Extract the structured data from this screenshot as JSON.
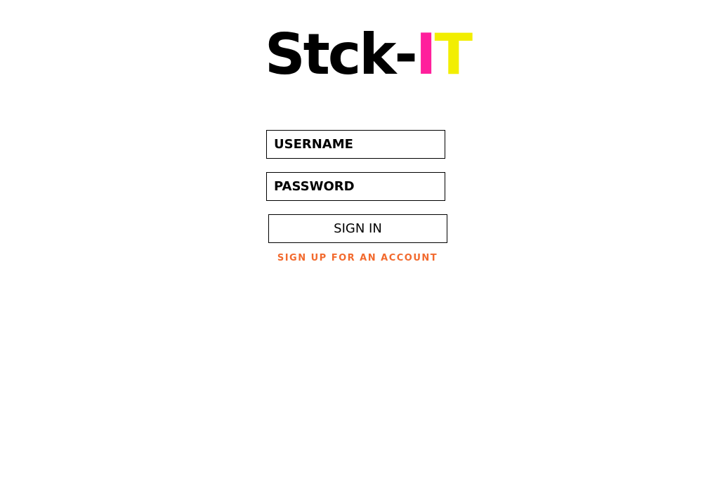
{
  "logo": {
    "text_base": "Stck-",
    "text_i": "I",
    "text_t": "T",
    "colors": {
      "base": "#000000",
      "i": "#ff1f9c",
      "t": "#f2ee00"
    }
  },
  "form": {
    "username_placeholder": "USERNAME",
    "password_placeholder": "PASSWORD",
    "signin_label": "SIGN IN",
    "signup_link": "SIGN UP FOR AN ACCOUNT"
  },
  "colors": {
    "accent_link": "#f26a2e",
    "border": "#000000",
    "background": "#ffffff"
  }
}
